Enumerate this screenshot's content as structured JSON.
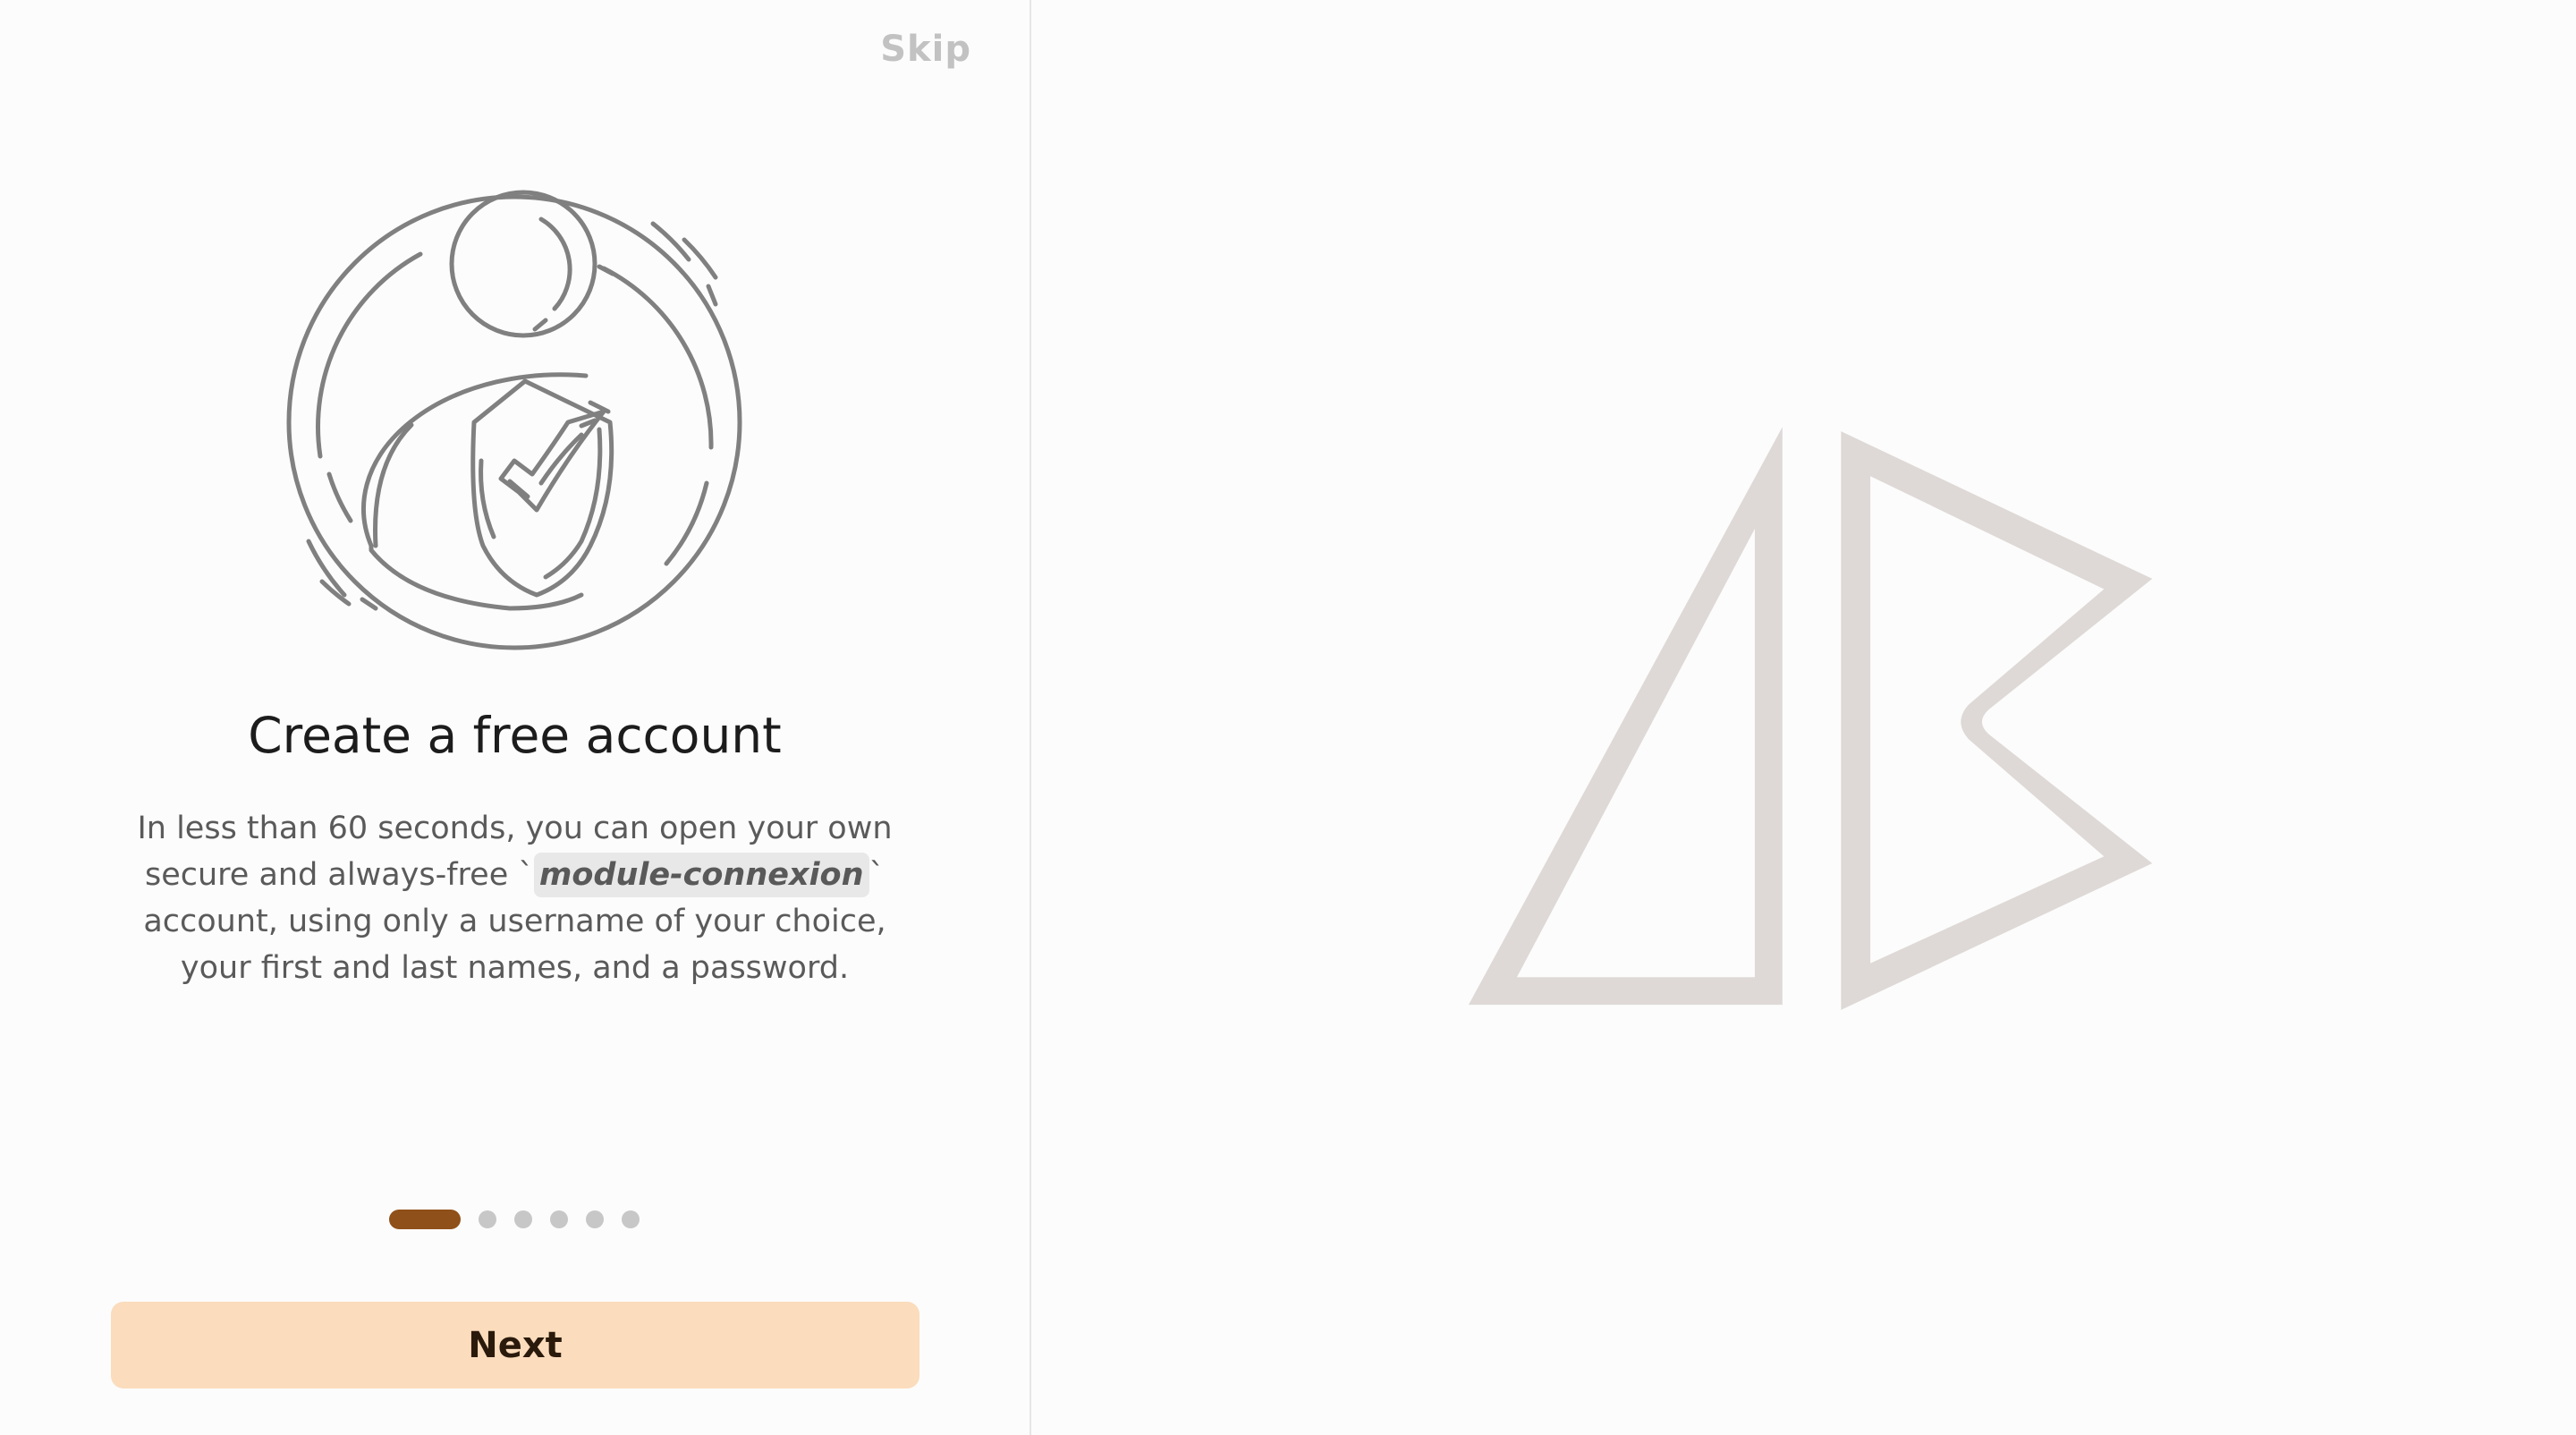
{
  "onboarding": {
    "skip_label": "Skip",
    "title": "Create a free account",
    "description_part1": "In less than 60 seconds, you can open your own secure and always-free `",
    "description_code": "module-connexion",
    "description_part2": "` account, using only a username of your choice, your first and last names, and a password.",
    "next_label": "Next",
    "pagination": {
      "total": 6,
      "current": 1
    },
    "illustration_icon": "user-shield-check-icon"
  },
  "brand": {
    "logo_icon": "triangle-logo-icon"
  },
  "colors": {
    "accent": "#8f5019",
    "button_bg": "#fbdcbc",
    "logo": "#ded9d6",
    "illustration": "#808080"
  }
}
